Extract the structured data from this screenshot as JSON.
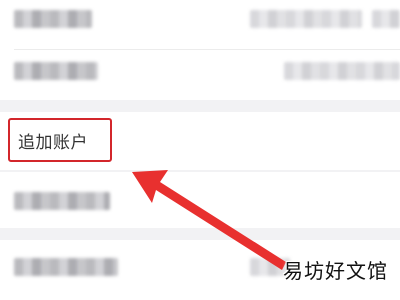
{
  "add_account": {
    "label": "追加账户"
  },
  "annotation": {
    "arrow_color": "#e8302f",
    "highlight_color": "#d3262b"
  },
  "watermark": {
    "text": "易坊好文馆"
  },
  "icons": [
    "arrow-annotation-icon"
  ]
}
